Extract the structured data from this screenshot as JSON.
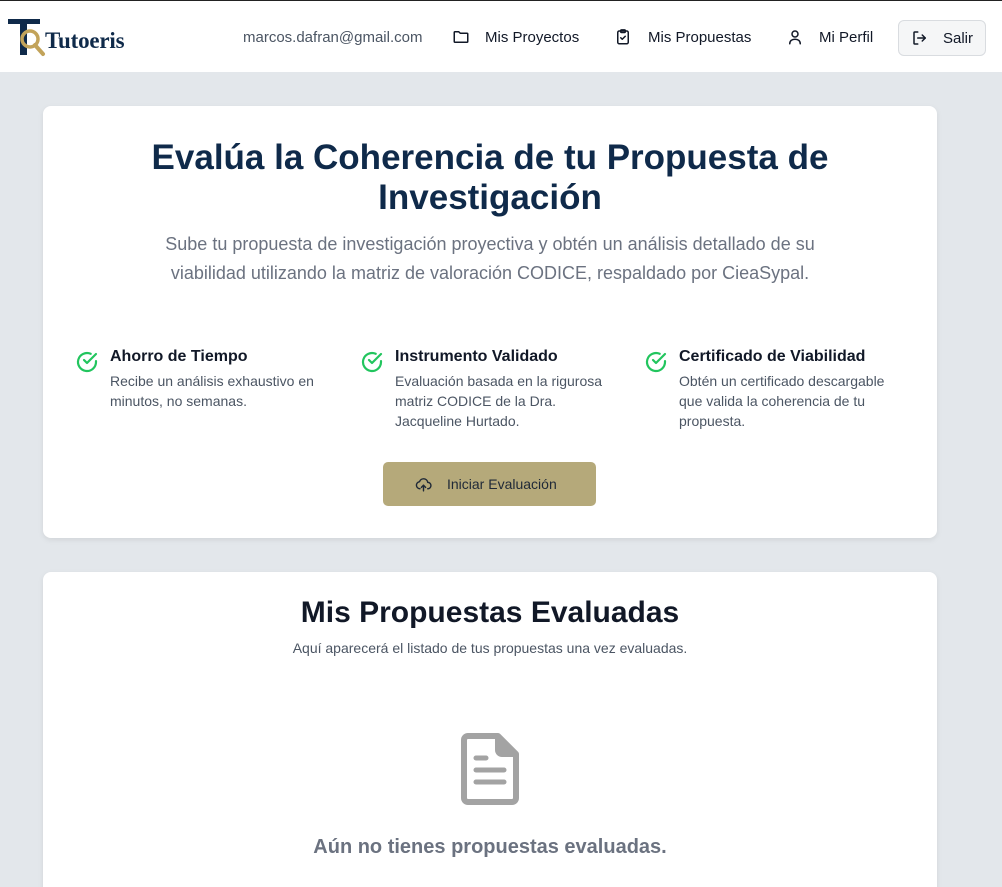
{
  "header": {
    "brand": "Tutoeris",
    "email": "marcos.dafran@gmail.com",
    "nav": {
      "projects": "Mis Proyectos",
      "proposals": "Mis Propuestas",
      "profile": "Mi Perfil",
      "logout": "Salir"
    }
  },
  "hero": {
    "title": "Evalúa la Coherencia de tu Propuesta de Investigación",
    "subtitle": "Sube tu propuesta de investigación proyectiva y obtén un análisis detallado de su viabilidad utilizando la matriz de valoración CODICE, respaldado por CieaSypal.",
    "features": [
      {
        "title": "Ahorro de Tiempo",
        "desc": "Recibe un análisis exhaustivo en minutos, no semanas."
      },
      {
        "title": "Instrumento Validado",
        "desc": "Evaluación basada en la rigurosa matriz CODICE de la Dra. Jacqueline Hurtado."
      },
      {
        "title": "Certificado de Viabilidad",
        "desc": "Obtén un certificado descargable que valida la coherencia de tu propuesta."
      }
    ],
    "cta_label": "Iniciar Evaluación"
  },
  "evaluated": {
    "title": "Mis Propuestas Evaluadas",
    "subtitle": "Aquí aparecerá el listado de tus propuestas una vez evaluadas.",
    "empty_message": "Aún no tienes propuestas evaluadas."
  },
  "colors": {
    "navy": "#0f2a4a",
    "accent_gold": "#b5a97a",
    "check_green": "#22c55e",
    "background": "#e3e7eb"
  }
}
